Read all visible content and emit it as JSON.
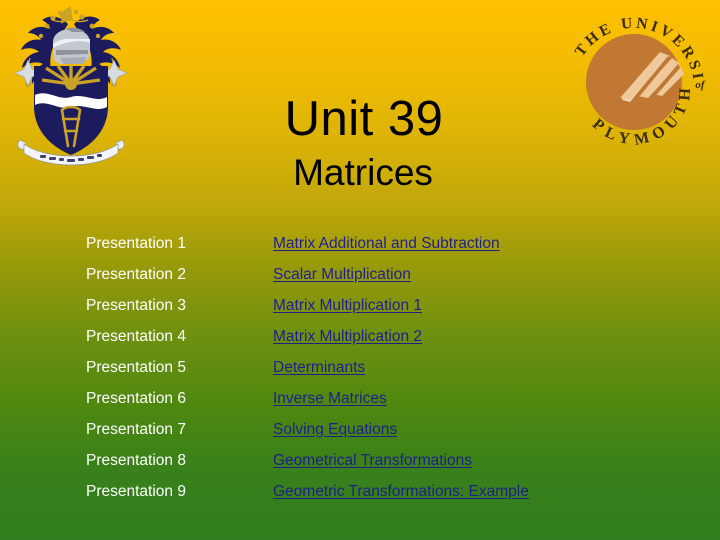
{
  "slide": {
    "title": "Unit 39",
    "subtitle": "Matrices",
    "background": {
      "top_color": "#FFC000",
      "mid_color": "#95990A",
      "bottom_color": "#2F7D1E"
    },
    "link_color": "#1F1F8C",
    "label_color": "#FFFFFF"
  },
  "crest": {
    "name": "university-coat-of-arms",
    "shield_color": "#1B1B5E",
    "gold_color": "#C9A227",
    "bird_color": "#35A02E",
    "helmet_color": "#B9BDC6"
  },
  "logo": {
    "name": "university-of-plymouth-logo",
    "disc_color": "#C07833",
    "ring_text_top": "THE UNIVERSITY",
    "ring_text_bottom": "PLYMOUTH",
    "ring_text_of": "of"
  },
  "contents": {
    "rows": [
      {
        "presentation": "Presentation 1",
        "link": "Matrix Additional and Subtraction"
      },
      {
        "presentation": "Presentation 2",
        "link": "Scalar Multiplication"
      },
      {
        "presentation": "Presentation 3",
        "link": "Matrix Multiplication 1"
      },
      {
        "presentation": "Presentation 4",
        "link": "Matrix Multiplication 2"
      },
      {
        "presentation": "Presentation 5",
        "link": "Determinants"
      },
      {
        "presentation": "Presentation 6",
        "link": "Inverse Matrices"
      },
      {
        "presentation": "Presentation 7",
        "link": "Solving Equations"
      },
      {
        "presentation": "Presentation 8",
        "link": "Geometrical Transformations"
      },
      {
        "presentation": "Presentation 9",
        "link": "Geometric Transformations: Example"
      }
    ]
  }
}
